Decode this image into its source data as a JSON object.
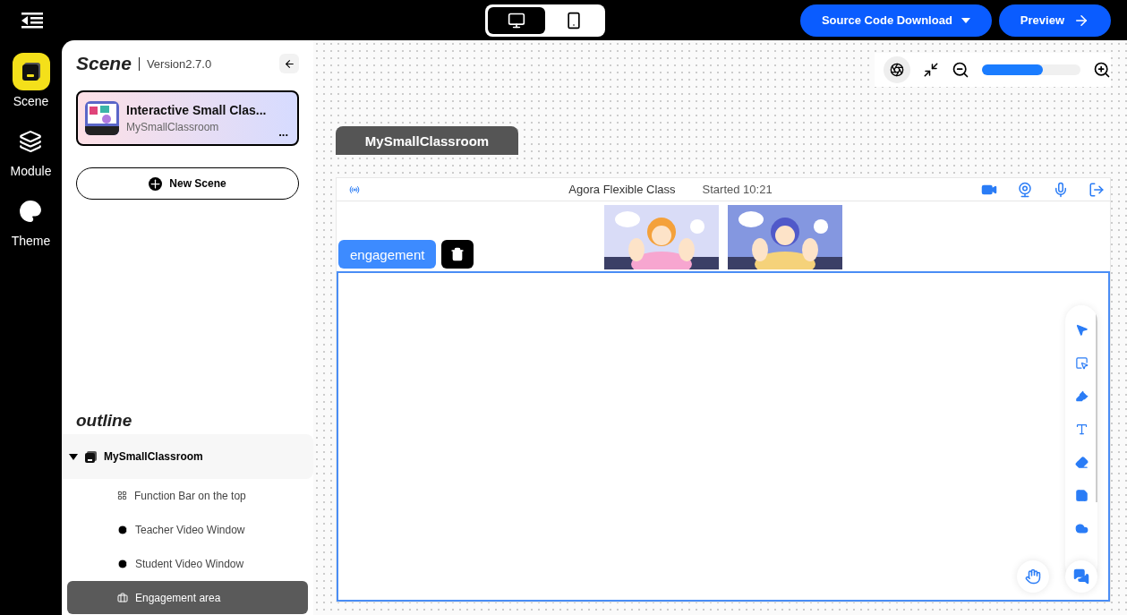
{
  "header": {
    "devices": [
      {
        "kind": "desktop",
        "selected": true
      },
      {
        "kind": "mobile",
        "selected": false
      }
    ],
    "download_button": "Source Code Download",
    "preview_button": "Preview"
  },
  "rail": [
    {
      "kind": "scene",
      "label": "Scene",
      "selected": true
    },
    {
      "kind": "module",
      "label": "Module",
      "selected": false
    },
    {
      "kind": "theme",
      "label": "Theme",
      "selected": false
    }
  ],
  "sidebar": {
    "title": "Scene",
    "version": "Version2.7.0",
    "scene_card": {
      "title": "Interactive Small Clas...",
      "subtitle": "MySmallClassroom",
      "menu": "..."
    },
    "new_scene_button": "New Scene",
    "outline_title": "outline",
    "outline": [
      {
        "label": "MySmallClassroom",
        "expanded": true,
        "selected": false,
        "children": [
          {
            "label": "Function Bar on the top",
            "kind": "bar",
            "selected": false
          },
          {
            "label": "Teacher Video Window",
            "kind": "video",
            "selected": false
          },
          {
            "label": "Student Video Window",
            "kind": "video",
            "selected": false
          },
          {
            "label": "Engagement area",
            "kind": "area",
            "selected": true
          }
        ]
      }
    ]
  },
  "canvas": {
    "zoom": {
      "level": 0.62
    },
    "tab": "MySmallClassroom",
    "classroom": {
      "title": "Agora Flexible Class",
      "started": "Started 10:21",
      "engagement_label": "engagement",
      "tools": [
        {
          "kind": "pointer"
        },
        {
          "kind": "select"
        },
        {
          "kind": "pen"
        },
        {
          "kind": "text"
        },
        {
          "kind": "eraser"
        },
        {
          "kind": "save"
        },
        {
          "kind": "cloud"
        }
      ]
    }
  }
}
